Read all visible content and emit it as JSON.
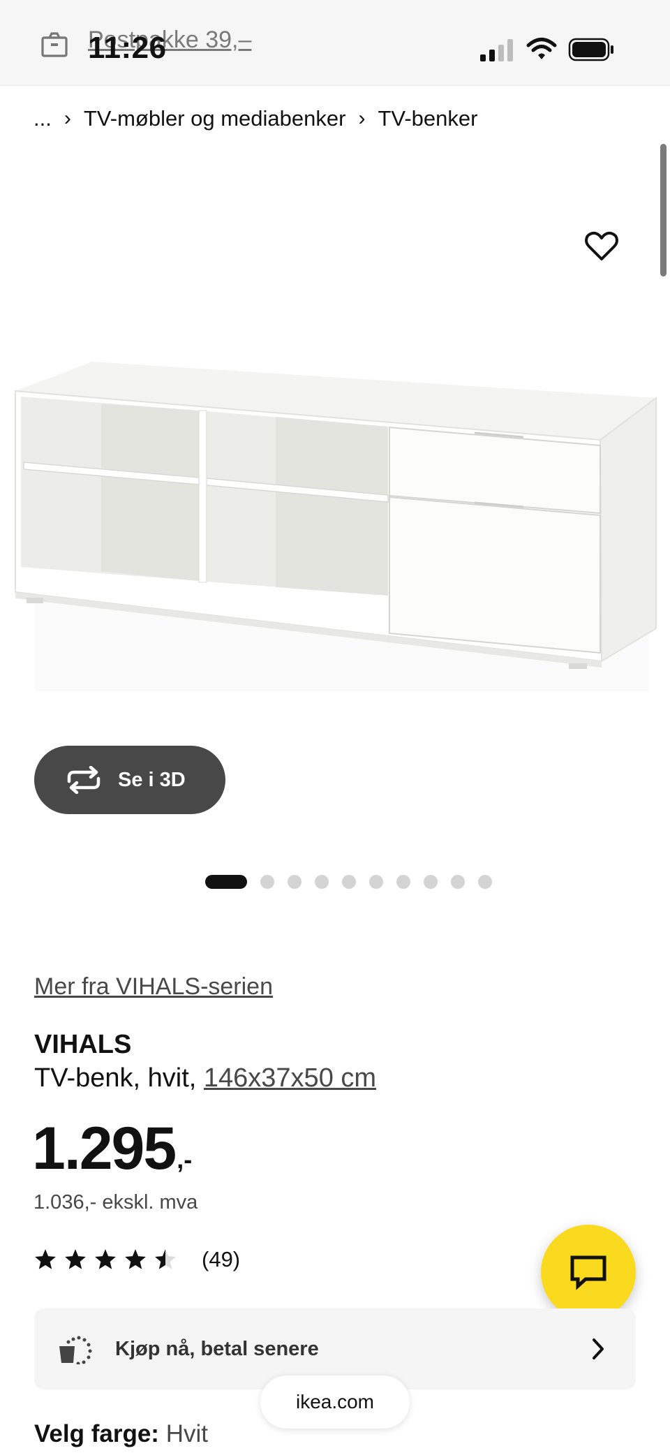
{
  "status_bar": {
    "time": "11:26",
    "promo_text": "Postpakke 39,–"
  },
  "breadcrumb": {
    "ellipsis": "...",
    "items": [
      "TV-møbler og mediabenker",
      "TV-benker"
    ]
  },
  "gallery": {
    "view_3d_label": "Se i 3D",
    "total_images": 10,
    "active_index": 0
  },
  "product": {
    "series_link": "Mer fra VIHALS-serien",
    "name": "VIHALS",
    "description": "TV-benk, hvit,",
    "dimensions": "146x37x50 cm",
    "price_main": "1.295",
    "price_suffix": ",-",
    "price_ex_vat": "1.036,- ekskl. mva",
    "rating": 4.5,
    "review_count": "(49)"
  },
  "klarna": {
    "label": "Kjøp nå, betal senere"
  },
  "url_bar": {
    "domain": "ikea.com"
  },
  "color_select": {
    "label": "Velg farge:",
    "value": "Hvit"
  },
  "colors": {
    "chat_fab": "#fada1e",
    "button_3d": "#484848",
    "text_primary": "#111111",
    "text_secondary": "#484848"
  },
  "icons": {
    "cart": "cart-icon",
    "heart": "heart-icon",
    "rotate": "rotate-3d-icon",
    "chat": "chat-icon",
    "klarna": "klarna-icon",
    "chevron": "chevron-right-icon"
  }
}
